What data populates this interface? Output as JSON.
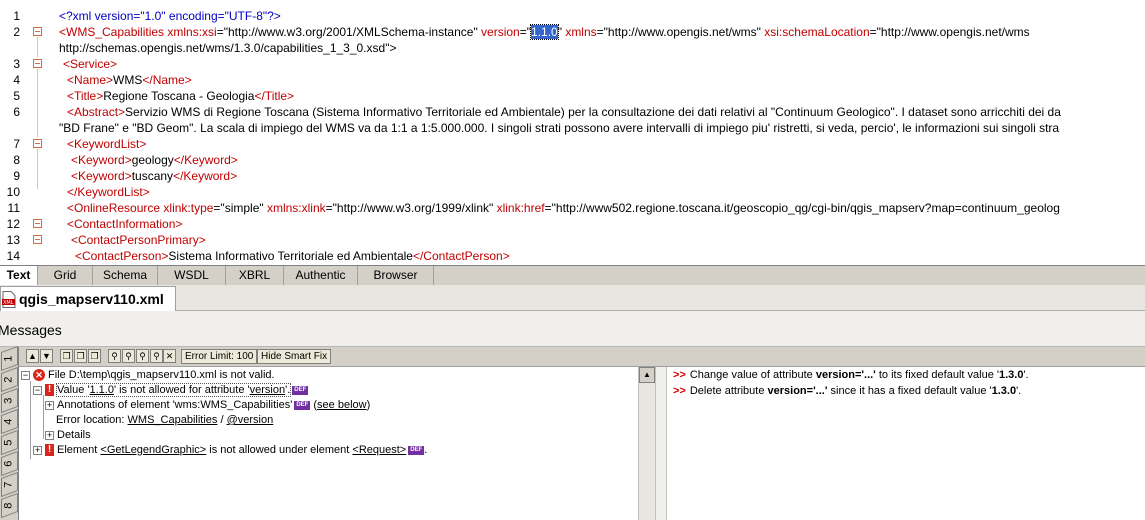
{
  "editor": {
    "line_numbers": [
      "1",
      "2",
      "3",
      "4",
      "5",
      "6",
      "7",
      "8",
      "9",
      "10",
      "11",
      "12",
      "13",
      "14"
    ],
    "l1": "<?xml version=\"1.0\" encoding=\"UTF-8\"?>",
    "l2a": "<WMS_Capabilities",
    "l2b": " xmlns:xsi",
    "l2c": "=\"http://www.w3.org/2001/XMLSchema-instance\" ",
    "l2d": "version",
    "l2e": "=\"",
    "l2f": "1.1.0",
    "l2g": "\" ",
    "l2h": "xmlns",
    "l2i": "=\"http://www.opengis.net/wms\" ",
    "l2j": "xsi:schemaLocation",
    "l2k": "=\"http://www.opengis.net/wms",
    "l2w": "http://schemas.opengis.net/wms/1.3.0/capabilities_1_3_0.xsd\">",
    "l3": "<Service>",
    "l4a": "<Name>",
    "l4b": "WMS",
    "l4c": "</Name>",
    "l5a": "<Title>",
    "l5b": "Regione Toscana - Geologia",
    "l5c": "</Title>",
    "l6a": "<Abstract>",
    "l6b": "Servizio WMS di Regione Toscana (Sistema Informativo Territoriale ed Ambientale) per la consultazione dei dati relativi al \"Continuum Geologico\". I dataset sono arricchiti dei da",
    "l6w": "\"BD Frane\" e \"BD Geom\". La scala di impiego del WMS va da 1:1 a 1:5.000.000. I singoli strati possono avere intervalli di impiego piu' ristretti, si veda, percio', le informazioni sui singoli stra",
    "l7": "<KeywordList>",
    "l8a": "<Keyword>",
    "l8b": "geology",
    "l8c": "</Keyword>",
    "l9a": "<Keyword>",
    "l9b": "tuscany",
    "l9c": "</Keyword>",
    "l10": "</KeywordList>",
    "l11a": "<OnlineResource",
    "l11b": " xlink:type",
    "l11c": "=\"simple\" ",
    "l11d": "xmlns:xlink",
    "l11e": "=\"http://www.w3.org/1999/xlink\" ",
    "l11f": "xlink:href",
    "l11g": "=\"http://www502.regione.toscana.it/geoscopio_qg/cgi-bin/qgis_mapserv?map=continuum_geolog",
    "l12": "<ContactInformation>",
    "l13": "<ContactPersonPrimary>",
    "l14a": "<ContactPerson>",
    "l14b": "Sistema Informativo Territoriale ed Ambientale",
    "l14c": "</ContactPerson>"
  },
  "view_tabs": [
    "Text",
    "Grid",
    "Schema",
    "WSDL",
    "XBRL",
    "Authentic",
    "Browser"
  ],
  "file_tab": {
    "icon": "xml-file-icon",
    "name": "qgis_mapserv110.xml"
  },
  "messages": {
    "title": "Messages",
    "side_tabs": [
      "1",
      "2",
      "3",
      "4",
      "5",
      "6",
      "7",
      "8"
    ],
    "toolbar": {
      "error_limit": "Error Limit: 100",
      "hide_smart_fix": "Hide Smart Fix"
    },
    "rows": {
      "file_invalid": "File D:\\temp\\qgis_mapserv110.xml is not valid.",
      "value_pre": "Value '",
      "value_val": "1.1.0",
      "value_mid": "' is not allowed for attribute '",
      "value_attr": "version",
      "value_end": "'.",
      "annotations": "Annotations of element 'wms:WMS_Capabilities'",
      "see_below": "see below",
      "error_location": "Error location: ",
      "loc_link1": "WMS_Capabilities",
      "loc_sep": " / ",
      "loc_link2": "@version",
      "details": "Details",
      "element_pre": "Element ",
      "element_link1": "<GetLegendGraphic>",
      "element_mid": " is not allowed under element ",
      "element_link2": "<Request>",
      "element_end": "."
    },
    "def_badge": "DEF",
    "smart_fixes": [
      {
        "pre": "Change value of attribute ",
        "bold1": "version='...'",
        "mid": " to its fixed default value '",
        "bold2": "1.3.0",
        "end": "'."
      },
      {
        "pre": "Delete attribute ",
        "bold1": "version='...'",
        "mid": " since it has a fixed default value '",
        "bold2": "1.3.0",
        "end": "'."
      }
    ]
  }
}
